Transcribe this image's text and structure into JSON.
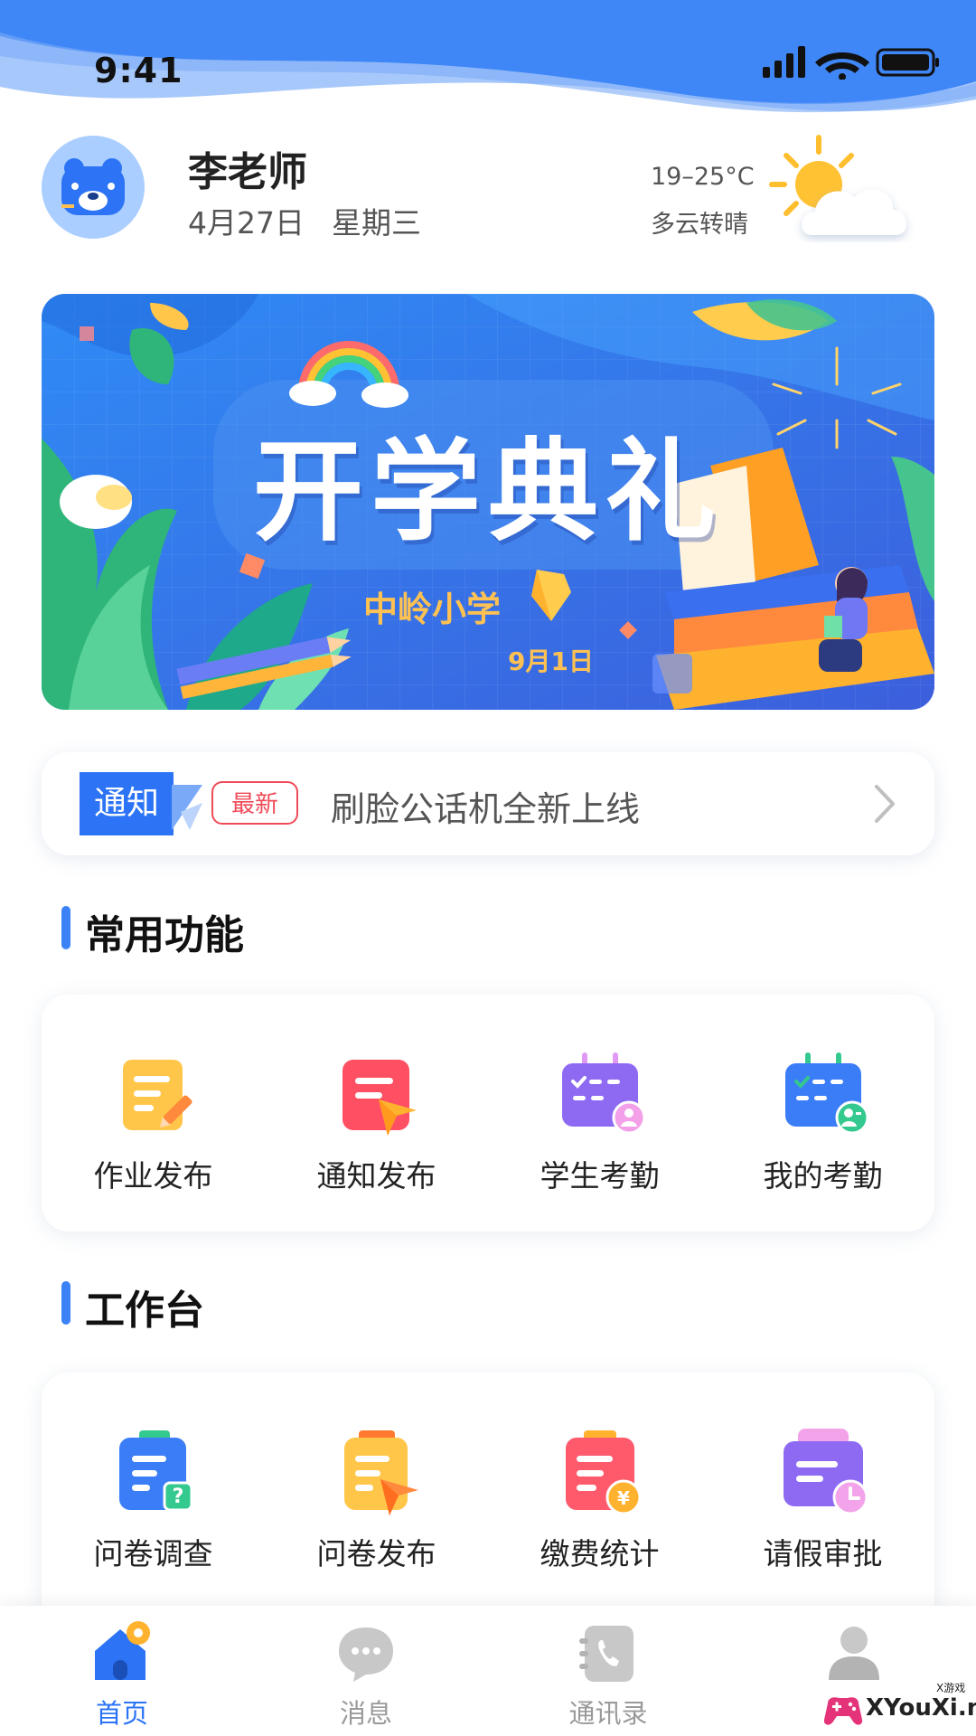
{
  "status_bar": {
    "time": "9:41"
  },
  "header": {
    "name": "李老师",
    "date": "4月27日",
    "weekday": "星期三",
    "weather": {
      "temp": "19–25°C",
      "desc": "多云转晴",
      "icon": "partly-cloudy-icon"
    }
  },
  "banner": {
    "title": "开学典礼",
    "school": "中岭小学",
    "date": "9月1日"
  },
  "notice": {
    "tag": "通知",
    "badge": "最新",
    "text": "刷脸公话机全新上线"
  },
  "common": {
    "title": "常用功能",
    "items": [
      {
        "label": "作业发布",
        "icon": "homework-publish-icon"
      },
      {
        "label": "通知发布",
        "icon": "notice-publish-icon"
      },
      {
        "label": "学生考勤",
        "icon": "student-attendance-icon"
      },
      {
        "label": "我的考勤",
        "icon": "my-attendance-icon"
      }
    ]
  },
  "workbench": {
    "title": "工作台",
    "items": [
      {
        "label": "问卷调查",
        "icon": "survey-icon"
      },
      {
        "label": "问卷发布",
        "icon": "survey-publish-icon"
      },
      {
        "label": "缴费统计",
        "icon": "payment-stats-icon"
      },
      {
        "label": "请假审批",
        "icon": "leave-approval-icon"
      }
    ]
  },
  "tabbar": {
    "items": [
      {
        "label": "首页",
        "active": true,
        "icon": "home-icon"
      },
      {
        "label": "消息",
        "active": false,
        "icon": "message-icon"
      },
      {
        "label": "通讯录",
        "active": false,
        "icon": "contacts-icon"
      },
      {
        "label": "",
        "active": false,
        "icon": "profile-icon"
      }
    ]
  },
  "watermark": {
    "text": "XYouXi.net",
    "small": "X游戏"
  },
  "colors": {
    "primary": "#2c74f5",
    "badge": "#ef4a57",
    "banner_accent": "#ffc252"
  }
}
